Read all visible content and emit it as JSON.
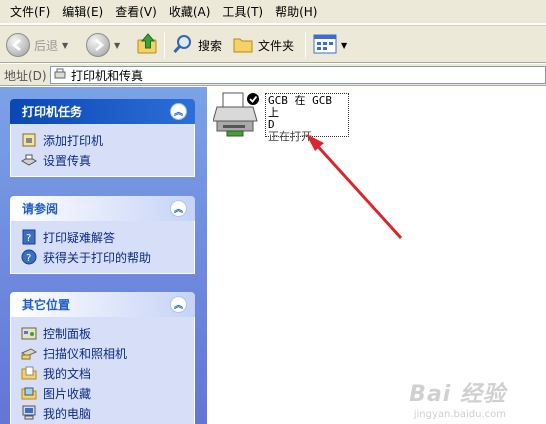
{
  "menubar": {
    "items": [
      "文件(F)",
      "编辑(E)",
      "查看(V)",
      "收藏(A)",
      "工具(T)",
      "帮助(H)"
    ]
  },
  "toolbar": {
    "back_label": "后退",
    "search_label": "搜索",
    "folders_label": "文件夹"
  },
  "address": {
    "label": "地址(D)",
    "value": "打印机和传真"
  },
  "taskpane": {
    "printer_tasks": {
      "title": "打印机任务",
      "items": [
        "添加打印机",
        "设置传真"
      ]
    },
    "see_also": {
      "title": "请参阅",
      "items": [
        "打印疑难解答",
        "获得关于打印的帮助"
      ]
    },
    "other_places": {
      "title": "其它位置",
      "items": [
        "控制面板",
        "扫描仪和照相机",
        "我的文档",
        "图片收藏",
        "我的电脑"
      ]
    }
  },
  "main": {
    "printer": {
      "name_line1": "GCB 在 GCB 上",
      "name_line2": "D",
      "status": "正在打开"
    }
  },
  "watermark": {
    "text": "Bai 经验",
    "sub": "jingyan.baidu.com"
  },
  "colors": {
    "annotation_arrow": "#d9262b",
    "taskpane_bg": "#7ba2e7",
    "panel_body": "#d6dff7",
    "link": "#0c2a85"
  }
}
